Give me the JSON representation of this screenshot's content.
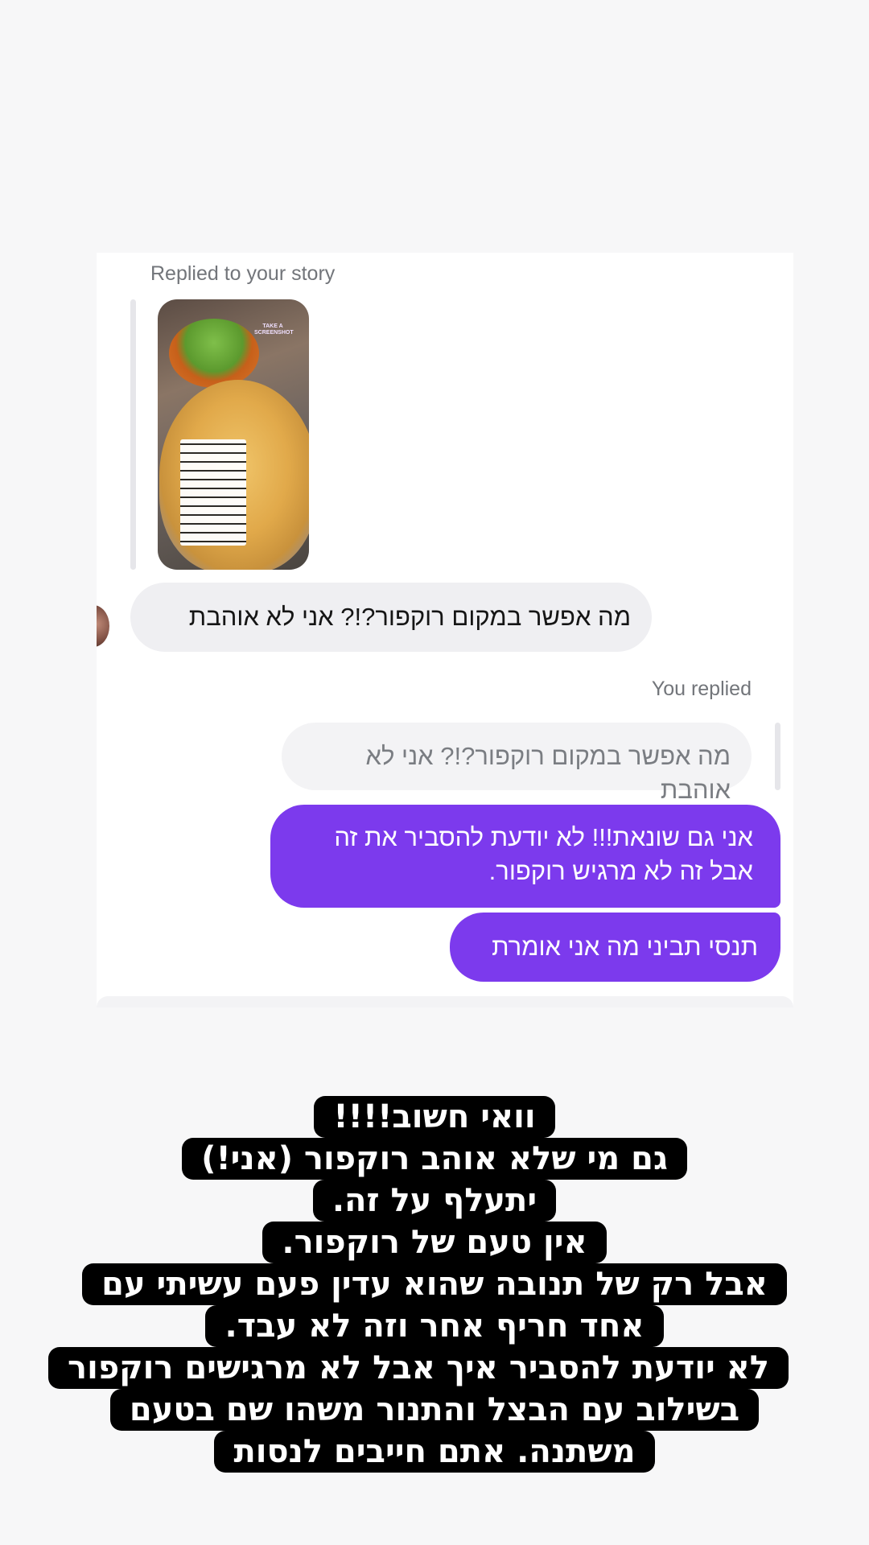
{
  "dm": {
    "replied_label": "Replied to your story",
    "story_thumb_badge": "TAKE A SCREENSHOT",
    "incoming_message": "מה אפשר במקום רוקפור?!? אני לא אוהבת",
    "you_replied_label": "You replied",
    "quoted_message": "מה אפשר במקום רוקפור?!? אני לא אוהבת",
    "outgoing_messages": [
      "אני גם שונאת!!! לא יודעת להסביר את זה אבל זה לא מרגיש רוקפור.",
      "תנסי תביני מה אני אומרת"
    ]
  },
  "story_overlay_lines": [
    "וואי חשוב!!!!",
    "גם מי שלא אוהב רוקפור (אני!)",
    "יתעלף על זה.",
    "אין טעם של רוקפור.",
    "אבל רק של תנובה שהוא עדין פעם עשיתי עם",
    "אחד חריף אחר  וזה לא עבד.",
    "לא יודעת להסביר איך אבל לא מרגישים רוקפור",
    "בשילוב עם הבצל והתנור משהו שם בטעם",
    "משתנה. אתם חייבים לנסות"
  ],
  "colors": {
    "outgoing_bubble": "#7c3aed",
    "incoming_bubble": "#efeff2",
    "overlay_bg": "#000000"
  }
}
